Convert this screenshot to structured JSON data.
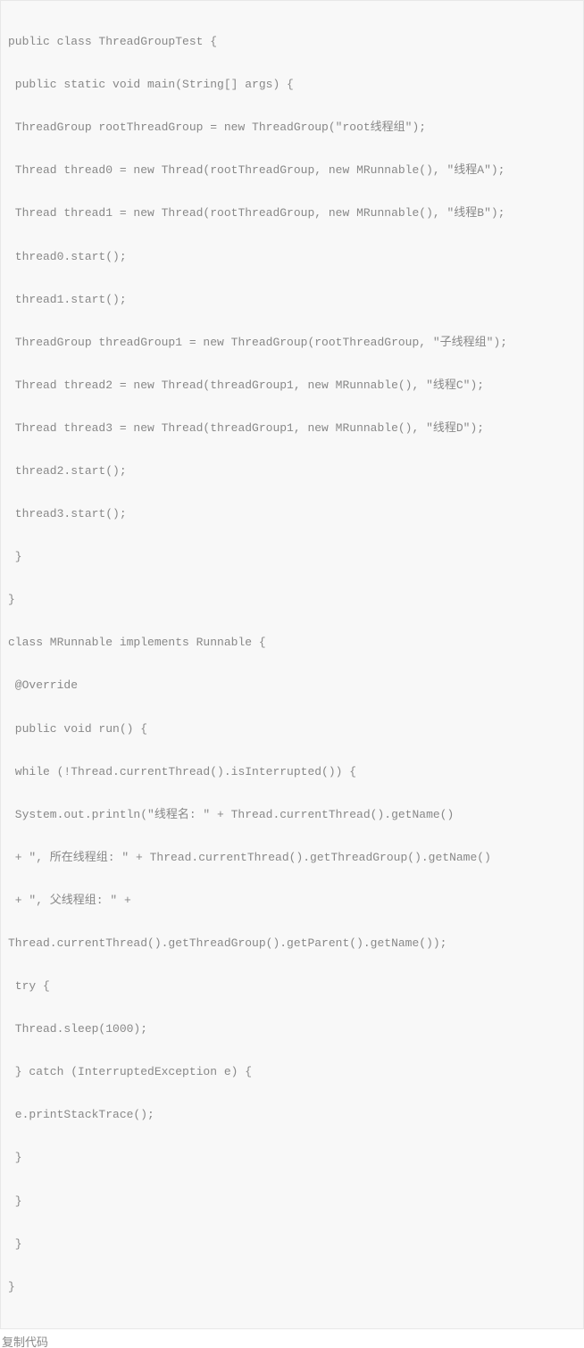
{
  "code": {
    "lines": [
      "public class ThreadGroupTest {",
      " public static void main(String[] args) {",
      " ThreadGroup rootThreadGroup = new ThreadGroup(\"root线程组\");",
      " Thread thread0 = new Thread(rootThreadGroup, new MRunnable(), \"线程A\");",
      " Thread thread1 = new Thread(rootThreadGroup, new MRunnable(), \"线程B\");",
      " thread0.start();",
      " thread1.start();",
      " ThreadGroup threadGroup1 = new ThreadGroup(rootThreadGroup, \"子线程组\");",
      " Thread thread2 = new Thread(threadGroup1, new MRunnable(), \"线程C\");",
      " Thread thread3 = new Thread(threadGroup1, new MRunnable(), \"线程D\");",
      " thread2.start();",
      " thread3.start();",
      " }",
      "}",
      "class MRunnable implements Runnable {",
      " @Override",
      " public void run() {",
      " while (!Thread.currentThread().isInterrupted()) {",
      " System.out.println(\"线程名: \" + Thread.currentThread().getName()",
      " + \", 所在线程组: \" + Thread.currentThread().getThreadGroup().getName()",
      " + \", 父线程组: \" +",
      "Thread.currentThread().getThreadGroup().getParent().getName());",
      " try {",
      " Thread.sleep(1000);",
      " } catch (InterruptedException e) {",
      " e.printStackTrace();",
      " }",
      " }",
      " }",
      "}"
    ]
  },
  "actions": {
    "copy_label": "复制代码"
  }
}
